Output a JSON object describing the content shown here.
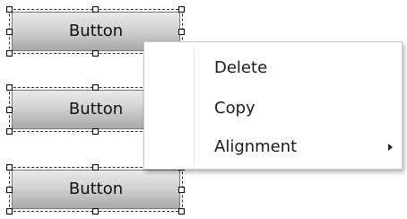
{
  "controls": [
    {
      "label": "Button",
      "selected": true
    },
    {
      "label": "Button",
      "selected": true
    },
    {
      "label": "Button",
      "selected": true
    }
  ],
  "context_menu": {
    "items": [
      {
        "label": "Delete",
        "has_submenu": false
      },
      {
        "label": "Copy",
        "has_submenu": false
      },
      {
        "label": "Alignment",
        "has_submenu": true,
        "submenu_icon": "chevron-right-icon"
      }
    ]
  },
  "colors": {
    "selection_border": "#2b2b2b",
    "menu_background": "#ffffff",
    "menu_border": "#c9c9c9"
  }
}
